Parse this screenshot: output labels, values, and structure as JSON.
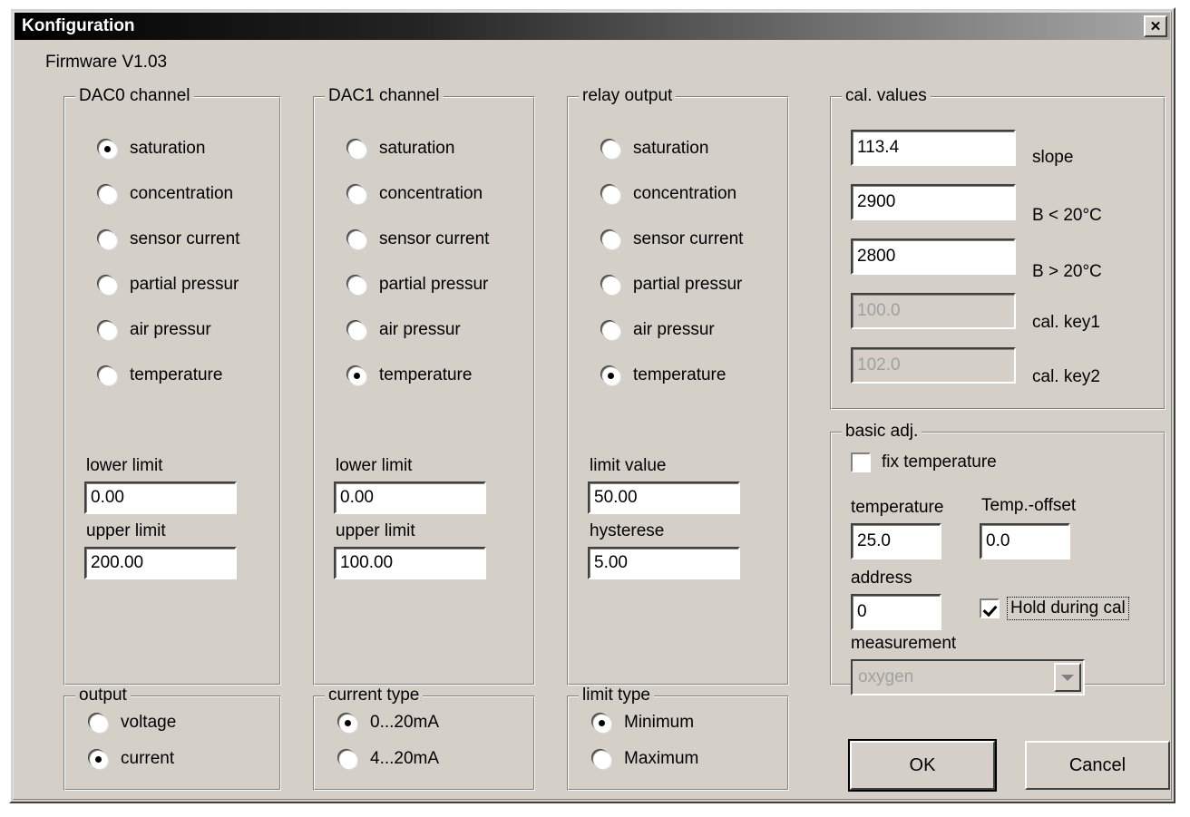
{
  "window": {
    "title": "Konfiguration",
    "close_icon": "close-icon",
    "firmware": "Firmware V1.03"
  },
  "dac0": {
    "legend": "DAC0 channel",
    "options": [
      "saturation",
      "concentration",
      "sensor current",
      "partial pressur",
      "air pressur",
      "temperature"
    ],
    "selected": "saturation",
    "lower_limit_label": "lower limit",
    "lower_limit_value": "0.00",
    "upper_limit_label": "upper limit",
    "upper_limit_value": "200.00"
  },
  "dac1": {
    "legend": "DAC1 channel",
    "options": [
      "saturation",
      "concentration",
      "sensor current",
      "partial pressur",
      "air pressur",
      "temperature"
    ],
    "selected": "temperature",
    "lower_limit_label": "lower limit",
    "lower_limit_value": "0.00",
    "upper_limit_label": "upper limit",
    "upper_limit_value": "100.00"
  },
  "relay": {
    "legend": "relay output",
    "options": [
      "saturation",
      "concentration",
      "sensor current",
      "partial pressur",
      "air pressur",
      "temperature"
    ],
    "selected": "temperature",
    "limit_value_label": "limit value",
    "limit_value": "50.00",
    "hysterese_label": "hysterese",
    "hysterese_value": "5.00"
  },
  "output": {
    "legend": "output",
    "options": [
      "voltage",
      "current"
    ],
    "selected": "current"
  },
  "current_type": {
    "legend": "current type",
    "options": [
      "0...20mA",
      "4...20mA"
    ],
    "selected": "0...20mA"
  },
  "limit_type": {
    "legend": "limit type",
    "options": [
      "Minimum",
      "Maximum"
    ],
    "selected": "Minimum"
  },
  "cal_values": {
    "legend": "cal. values",
    "rows": [
      {
        "value": "113.4",
        "label": "slope",
        "disabled": false
      },
      {
        "value": "2900",
        "label": "B < 20°C",
        "disabled": false
      },
      {
        "value": "2800",
        "label": "B > 20°C",
        "disabled": false
      },
      {
        "value": "100.0",
        "label": "cal. key1",
        "disabled": true
      },
      {
        "value": "102.0",
        "label": "cal. key2",
        "disabled": true
      }
    ]
  },
  "basic_adj": {
    "legend": "basic adj.",
    "fix_temperature_label": "fix temperature",
    "fix_temperature_checked": false,
    "temperature_label": "temperature",
    "temperature_value": "25.0",
    "temp_offset_label": "Temp.-offset",
    "temp_offset_value": "0.0",
    "address_label": "address",
    "address_value": "0",
    "hold_during_cal_label": "Hold during cal",
    "hold_during_cal_checked": true,
    "measurement_label": "measurement",
    "measurement_value": "oxygen",
    "measurement_disabled": true
  },
  "buttons": {
    "ok": "OK",
    "cancel": "Cancel"
  },
  "colors": {
    "face": "#d4d0c8",
    "shadow": "#808080",
    "dark": "#404040",
    "light": "#ffffff",
    "disabled_text": "#a0a0a0"
  }
}
